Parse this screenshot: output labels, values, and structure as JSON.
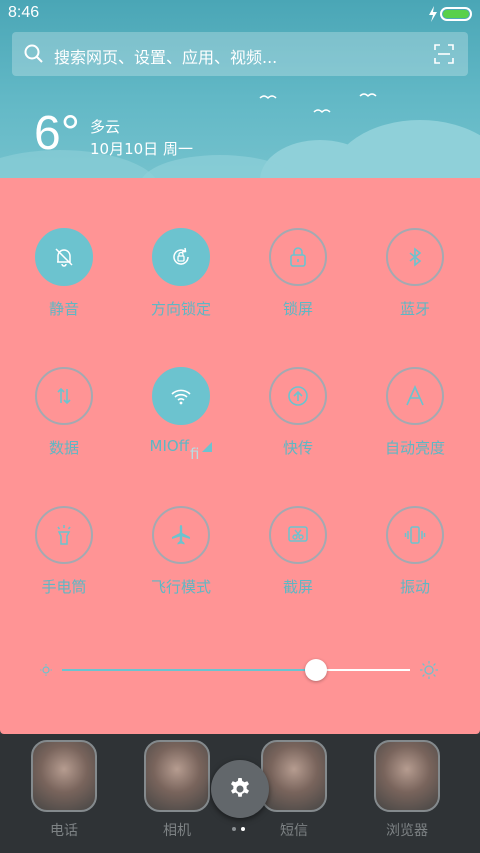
{
  "status_bar": {
    "time": "8:46",
    "battery_level_percent": 100,
    "battery_color": "#59d04a"
  },
  "search": {
    "placeholder": "搜索网页、设置、应用、视频..."
  },
  "weather": {
    "temperature": "6°",
    "condition": "多云",
    "date": "10月10日 周一"
  },
  "quick_settings": {
    "accent_color": "#6cc3cf",
    "panel_color": "#ff9495",
    "tiles": [
      {
        "label": "静音",
        "icon": "bell-off-icon",
        "on": true
      },
      {
        "label": "方向锁定",
        "icon": "rotation-lock-icon",
        "on": true
      },
      {
        "label": "锁屏",
        "icon": "lock-icon",
        "on": false
      },
      {
        "label": "蓝牙",
        "icon": "bluetooth-icon",
        "on": false
      },
      {
        "label": "数据",
        "icon": "data-arrows-icon",
        "on": false
      },
      {
        "label": "MIOff",
        "icon": "wifi-icon",
        "on": true
      },
      {
        "label": "快传",
        "icon": "upload-icon",
        "on": false
      },
      {
        "label": "自动亮度",
        "icon": "auto-brightness-icon",
        "on": false
      },
      {
        "label": "手电筒",
        "icon": "flashlight-icon",
        "on": false
      },
      {
        "label": "飞行模式",
        "icon": "airplane-icon",
        "on": false
      },
      {
        "label": "截屏",
        "icon": "screenshot-icon",
        "on": false
      },
      {
        "label": "振动",
        "icon": "vibrate-icon",
        "on": false
      }
    ],
    "brightness_percent": 73
  },
  "dock": {
    "apps": [
      {
        "label": "电话"
      },
      {
        "label": "相机"
      },
      {
        "label": "短信"
      },
      {
        "label": "浏览器"
      }
    ],
    "page_count": 2,
    "active_page": 2
  }
}
